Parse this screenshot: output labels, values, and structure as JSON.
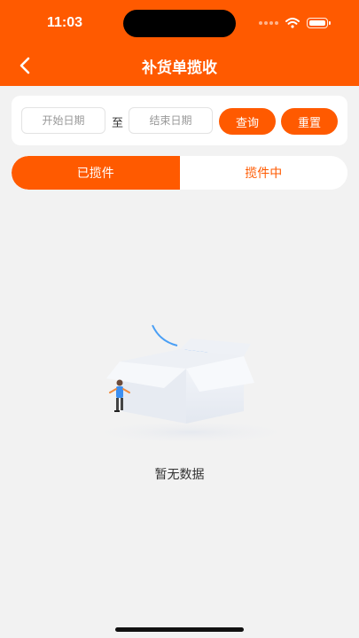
{
  "status_bar": {
    "time": "11:03"
  },
  "header": {
    "title": "补货单揽收"
  },
  "filter": {
    "start_placeholder": "开始日期",
    "to_label": "至",
    "end_placeholder": "结束日期",
    "query_label": "查询",
    "reset_label": "重置"
  },
  "tabs": [
    {
      "label": "已揽件",
      "active": true
    },
    {
      "label": "揽件中",
      "active": false
    }
  ],
  "empty": {
    "text": "暂无数据"
  },
  "colors": {
    "primary": "#ff5a00",
    "background": "#f2f2f2"
  }
}
